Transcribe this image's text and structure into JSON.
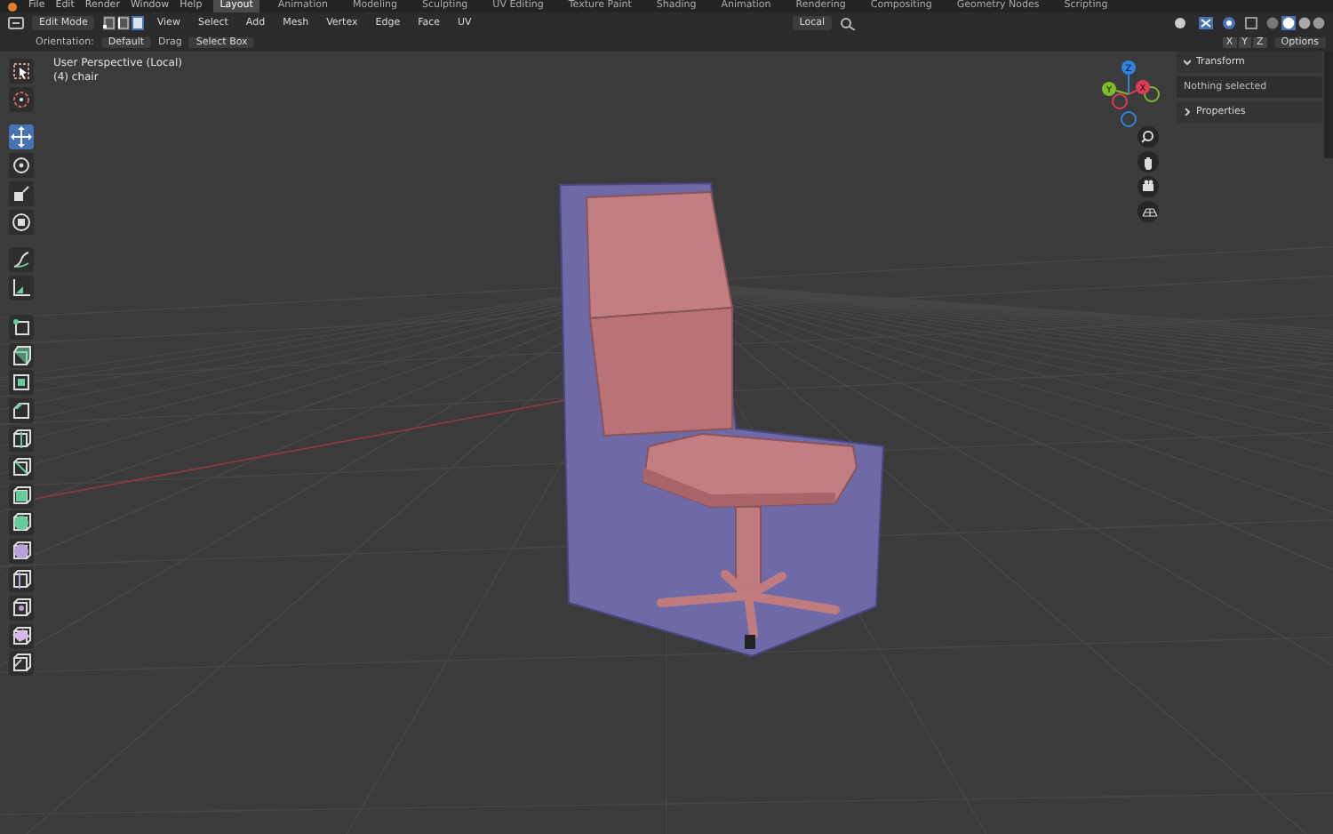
{
  "top_menu": [
    "File",
    "Edit",
    "Render",
    "Window",
    "Help"
  ],
  "workspace_tabs": [
    {
      "label": "Layout",
      "selected": true
    },
    {
      "label": "Animation",
      "selected": false
    },
    {
      "label": "Modeling",
      "selected": false
    },
    {
      "label": "Sculpting",
      "selected": false
    },
    {
      "label": "UV Editing",
      "selected": false
    },
    {
      "label": "Texture Paint",
      "selected": false
    },
    {
      "label": "Shading",
      "selected": false
    },
    {
      "label": "Animation",
      "selected": false
    },
    {
      "label": "Rendering",
      "selected": false
    },
    {
      "label": "Compositing",
      "selected": false
    },
    {
      "label": "Geometry Nodes",
      "selected": false
    },
    {
      "label": "Scripting",
      "selected": false
    }
  ],
  "header": {
    "mode": "Edit Mode",
    "select_modes": [
      {
        "kind": "vertex",
        "selected": false
      },
      {
        "kind": "edge",
        "selected": false
      },
      {
        "kind": "face",
        "selected": true
      }
    ],
    "menus": [
      "View",
      "Select",
      "Add",
      "Mesh",
      "Vertex",
      "Edge",
      "Face",
      "UV"
    ],
    "transform_space": "Local"
  },
  "tool_settings": {
    "orientation_label": "Orientation:",
    "orientation": "Default",
    "drag_label": "Drag",
    "drag": "Select Box",
    "axes": [
      "X",
      "Y",
      "Z"
    ],
    "options": "Options"
  },
  "viewport": {
    "info": [
      "User Perspective (Local)",
      "(4) chair"
    ],
    "gizmo_axes": [
      "X",
      "Y",
      "Z"
    ]
  },
  "toolbar": [
    {
      "kind": "select",
      "selected": false
    },
    {
      "kind": "cursor",
      "selected": false
    },
    {
      "kind": "move",
      "selected": true
    },
    {
      "kind": "rotate",
      "selected": false
    },
    {
      "kind": "scale",
      "selected": false
    },
    {
      "kind": "transform",
      "selected": false
    },
    {
      "kind": "annotate",
      "selected": false
    },
    {
      "kind": "measure",
      "selected": false
    },
    {
      "kind": "addcube",
      "selected": false
    },
    {
      "kind": "extrude",
      "selected": false
    },
    {
      "kind": "inset",
      "selected": false
    },
    {
      "kind": "bevel",
      "selected": false
    },
    {
      "kind": "loopcut",
      "selected": false
    },
    {
      "kind": "knife",
      "selected": false
    },
    {
      "kind": "polybuild",
      "selected": false
    },
    {
      "kind": "spin",
      "selected": false
    },
    {
      "kind": "smooth",
      "selected": false
    },
    {
      "kind": "edgeslide",
      "selected": false
    },
    {
      "kind": "shrink",
      "selected": false
    },
    {
      "kind": "shear",
      "selected": false
    },
    {
      "kind": "rip",
      "selected": false
    }
  ],
  "sidebar": {
    "panels": [
      {
        "title": "Transform",
        "expanded": true,
        "content": "Nothing selected"
      },
      {
        "title": "Properties",
        "expanded": false
      }
    ]
  }
}
